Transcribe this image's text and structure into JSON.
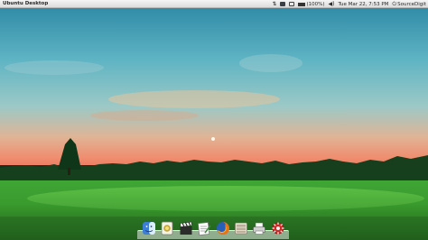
{
  "panel": {
    "title": "Ubuntu Desktop",
    "indicators": [
      {
        "icon": "network-icon"
      },
      {
        "icon": "keyboard-layout-icon"
      },
      {
        "icon": "mail-icon"
      },
      {
        "icon": "battery-icon",
        "label": "(100%)",
        "level": 1.0
      },
      {
        "icon": "volume-icon"
      }
    ],
    "clock": "Tue Mar 22, 7:53 PM",
    "user": "SourceDigit"
  },
  "dock": {
    "launchers": [
      {
        "icon": "finder-icon"
      },
      {
        "icon": "photos-icon"
      },
      {
        "icon": "clapper-board-icon"
      },
      {
        "icon": "text-editor-icon"
      },
      {
        "icon": "firefox-icon"
      },
      {
        "icon": "file-manager-icon"
      },
      {
        "icon": "printer-icon"
      },
      {
        "icon": "settings-icon"
      }
    ]
  },
  "colors": {
    "panel": "#e6e6e6",
    "sky_top": "#2f8ea9",
    "sky_horizon": "#f1936b",
    "grass": "#3c9b2f"
  }
}
